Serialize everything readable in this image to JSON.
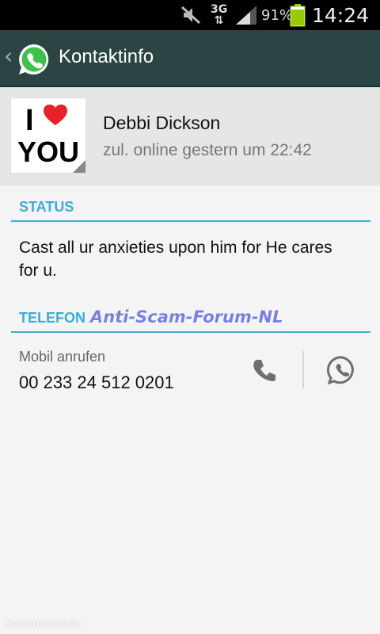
{
  "status_bar": {
    "network": "3G",
    "network_arrows": "⇅",
    "battery_percent": "91%",
    "battery_level": 0.91,
    "time": "14:24"
  },
  "action_bar": {
    "title": "Kontaktinfo",
    "back_icon": "chevron-left-icon",
    "app_icon": "whatsapp-logo"
  },
  "contact": {
    "name": "Debbi Dickson",
    "last_seen": "zul. online gestern um 22:42",
    "avatar": {
      "line1": "I",
      "line2": "YOU"
    }
  },
  "sections": {
    "status_header": "STATUS",
    "status_text": "Cast all ur anxieties upon him for He cares for u.",
    "phone_header": "TELEFON"
  },
  "phone": {
    "label": "Mobil anrufen",
    "number": "00 233 24 512 0201",
    "call_icon": "phone-icon",
    "chat_icon": "whatsapp-icon"
  },
  "watermarks": {
    "center": "Anti-Scam-Forum-NL",
    "footer": "Scammerlist.de"
  },
  "colors": {
    "accent": "#3aaed8",
    "action_bar": "#2c4544",
    "heart": "#e8202a"
  }
}
